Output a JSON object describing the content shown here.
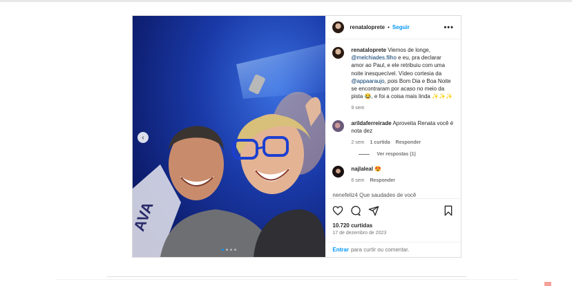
{
  "post": {
    "username": "renataloprete",
    "separator": "•",
    "follow_label": "Seguir",
    "more_label": "•••",
    "prev_label": "‹",
    "carousel_count": 4,
    "carousel_active": 0
  },
  "caption": {
    "username": "renataloprete",
    "text_1": " Viemos de longe, ",
    "mention_1": "@melchiades.filho",
    "text_2": " e eu, pra declarar amor ao Paul, e ele retribuiu com uma noite inesquecível. Vídeo cortesia da ",
    "mention_2": "@appaaraujo",
    "text_3": ", pois Bom Dia e Boa Noite se encontraram por acaso no meio da pista 😂, e foi a coisa mais linda ✨✨✨",
    "time": "9 sem"
  },
  "comments": [
    {
      "username": "arildaferreirade",
      "text": " Aproveita Renata você é nota dez",
      "time": "2 sem",
      "likes": "1 curtida",
      "reply_label": "Responder",
      "view_replies": "Ver respostas (1)"
    },
    {
      "username": "najlaleal",
      "text": " 😍",
      "time": "6 sem",
      "reply_label": "Responder"
    }
  ],
  "partial_comment": "nenefeliz4 Que saudades de você",
  "likes_count": "10.720 curtidas",
  "date": "17 de dezembro de 2023",
  "add_comment": {
    "link": "Entrar",
    "text": "para curtir ou comentar."
  },
  "icons": {
    "like": "heart-icon",
    "comment": "comment-icon",
    "share": "share-icon",
    "save": "bookmark-icon"
  },
  "colors": {
    "accent": "#0095f6",
    "mention": "#00376b",
    "muted": "#737373"
  }
}
